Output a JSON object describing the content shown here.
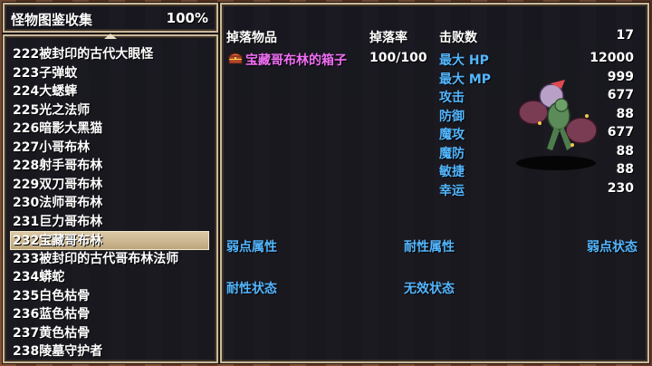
{
  "header": {
    "title": "怪物图鉴收集",
    "completion": "100%"
  },
  "list": {
    "items": [
      "222被封印的古代大眼怪",
      "223子弹蚊",
      "224大蟋蟀",
      "225光之法师",
      "226暗影大黑猫",
      "227小哥布林",
      "228射手哥布林",
      "229双刀哥布林",
      "230法师哥布林",
      "231巨力哥布林",
      "232宝藏哥布林",
      "233被封印的古代哥布林法师",
      "234蟒蛇",
      "235白色枯骨",
      "236蓝色枯骨",
      "237黄色枯骨",
      "238陵墓守护者"
    ],
    "selected_index": 10
  },
  "drops": {
    "header_item": "掉落物品",
    "header_rate": "掉落率",
    "item_name": "宝藏哥布林的箱子",
    "item_rate": "100/100",
    "item_icon": "treasure-chest-icon"
  },
  "stats": {
    "defeated_label": "击败数",
    "defeated_value": "17",
    "rows": [
      {
        "label": "最大 HP",
        "value": "12000"
      },
      {
        "label": "最大 MP",
        "value": "999"
      },
      {
        "label": "攻击",
        "value": "677"
      },
      {
        "label": "防御",
        "value": "88"
      },
      {
        "label": "魔攻",
        "value": "677"
      },
      {
        "label": "魔防",
        "value": "88"
      },
      {
        "label": "敏捷",
        "value": "88"
      },
      {
        "label": "幸运",
        "value": "230"
      }
    ]
  },
  "attributes": {
    "weak_attr": "弱点属性",
    "resist_attr": "耐性属性",
    "weak_state": "弱点状态",
    "resist_state": "耐性状态",
    "immune_state": "无效状态"
  },
  "monster": {
    "icon": "treasure-goblin-sprite"
  },
  "colors": {
    "label_blue": "#53b7ff",
    "item_magenta": "#f26ff6",
    "window_bg": "#14161f",
    "border": "#cbb89a",
    "selected": "#cdb991"
  }
}
